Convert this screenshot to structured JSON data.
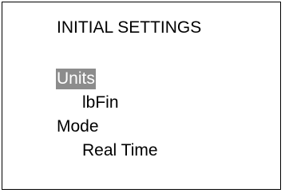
{
  "screen": {
    "title": "INITIAL SETTINGS",
    "items": [
      {
        "label": "Units",
        "value": "lbFin",
        "selected": true
      },
      {
        "label": "Mode",
        "value": "Real Time",
        "selected": false
      }
    ],
    "colors": {
      "highlight_bg": "#8c8c8c",
      "highlight_fg": "#ffffff",
      "text": "#000000",
      "background": "#ffffff"
    }
  }
}
